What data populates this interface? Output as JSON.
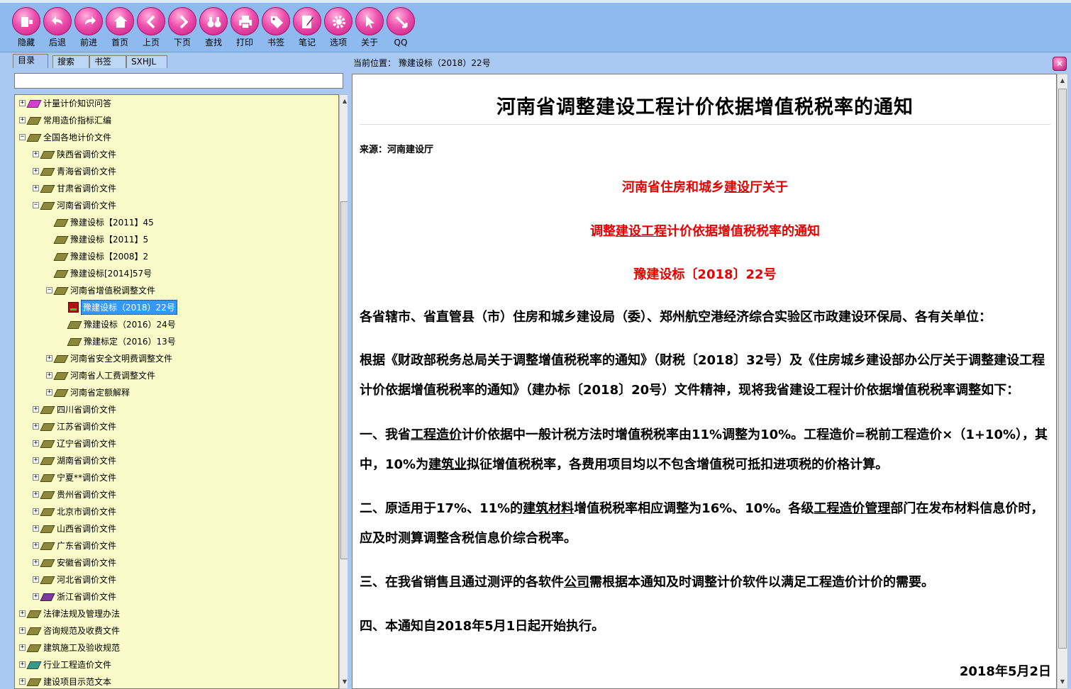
{
  "toolbar": {
    "buttons": [
      {
        "label": "隐藏",
        "icon": "hide-icon"
      },
      {
        "label": "后退",
        "icon": "back-icon"
      },
      {
        "label": "前进",
        "icon": "forward-icon"
      },
      {
        "label": "首页",
        "icon": "home-icon"
      },
      {
        "label": "上页",
        "icon": "prev-page-icon"
      },
      {
        "label": "下页",
        "icon": "next-page-icon"
      },
      {
        "label": "查找",
        "icon": "binoculars-icon"
      },
      {
        "label": "打印",
        "icon": "printer-icon"
      },
      {
        "label": "书签",
        "icon": "bookmark-tag-icon"
      },
      {
        "label": "笔记",
        "icon": "notes-icon"
      },
      {
        "label": "选项",
        "icon": "gear-icon"
      },
      {
        "label": "关于",
        "icon": "cursor-icon"
      },
      {
        "label": "QQ",
        "icon": "qq-icon"
      }
    ]
  },
  "tabs": [
    "目录",
    "搜索",
    "书签",
    "SXHJL"
  ],
  "search": {
    "value": ""
  },
  "tree": [
    {
      "label": "计量计价知识问答",
      "level": 0,
      "toggle": "+",
      "icon": "pink"
    },
    {
      "label": "常用造价指标汇编",
      "level": 0,
      "toggle": "+",
      "icon": "olive"
    },
    {
      "label": "全国各地计价文件",
      "level": 0,
      "toggle": "-",
      "icon": "olive"
    },
    {
      "label": "陕西省调价文件",
      "level": 1,
      "toggle": "+",
      "icon": "olive"
    },
    {
      "label": "青海省调价文件",
      "level": 1,
      "toggle": "+",
      "icon": "olive"
    },
    {
      "label": "甘肃省调价文件",
      "level": 1,
      "toggle": "+",
      "icon": "olive"
    },
    {
      "label": "河南省调价文件",
      "level": 1,
      "toggle": "-",
      "icon": "olive"
    },
    {
      "label": "豫建设标【2011】45",
      "level": 2,
      "toggle": "",
      "icon": "olive"
    },
    {
      "label": "豫建设标【2011】5",
      "level": 2,
      "toggle": "",
      "icon": "olive"
    },
    {
      "label": "豫建设标【2008】2",
      "level": 2,
      "toggle": "",
      "icon": "olive"
    },
    {
      "label": "豫建设标[2014]57号",
      "level": 2,
      "toggle": "",
      "icon": "olive"
    },
    {
      "label": "河南省增值税调整文件",
      "level": 2,
      "toggle": "-",
      "icon": "olive"
    },
    {
      "label": "豫建设标（2018）22号",
      "level": 3,
      "toggle": "",
      "icon": "doc",
      "selected": true
    },
    {
      "label": "豫建设标（2016）24号",
      "level": 3,
      "toggle": "",
      "icon": "olive"
    },
    {
      "label": "豫建标定（2016）13号",
      "level": 3,
      "toggle": "",
      "icon": "olive"
    },
    {
      "label": "河南省安全文明费调整文件",
      "level": 2,
      "toggle": "+",
      "icon": "olive"
    },
    {
      "label": "河南省人工费调整文件",
      "level": 2,
      "toggle": "+",
      "icon": "olive"
    },
    {
      "label": "河南省定额解释",
      "level": 2,
      "toggle": "+",
      "icon": "olive"
    },
    {
      "label": "四川省调价文件",
      "level": 1,
      "toggle": "+",
      "icon": "olive"
    },
    {
      "label": "江苏省调价文件",
      "level": 1,
      "toggle": "+",
      "icon": "olive"
    },
    {
      "label": "辽宁省调价文件",
      "level": 1,
      "toggle": "+",
      "icon": "olive"
    },
    {
      "label": "湖南省调价文件",
      "level": 1,
      "toggle": "+",
      "icon": "olive"
    },
    {
      "label": "宁夏**调价文件",
      "level": 1,
      "toggle": "+",
      "icon": "olive"
    },
    {
      "label": "贵州省调价文件",
      "level": 1,
      "toggle": "+",
      "icon": "olive"
    },
    {
      "label": "北京市调价文件",
      "level": 1,
      "toggle": "+",
      "icon": "olive"
    },
    {
      "label": "山西省调价文件",
      "level": 1,
      "toggle": "+",
      "icon": "olive"
    },
    {
      "label": "广东省调价文件",
      "level": 1,
      "toggle": "+",
      "icon": "olive"
    },
    {
      "label": "安徽省调价文件",
      "level": 1,
      "toggle": "+",
      "icon": "olive"
    },
    {
      "label": "河北省调价文件",
      "level": 1,
      "toggle": "+",
      "icon": "olive"
    },
    {
      "label": "浙江省调价文件",
      "level": 1,
      "toggle": "+",
      "icon": "purple"
    },
    {
      "label": "法律法规及管理办法",
      "level": 0,
      "toggle": "+",
      "icon": "olive"
    },
    {
      "label": "咨询规范及收费文件",
      "level": 0,
      "toggle": "+",
      "icon": "olive"
    },
    {
      "label": "建筑施工及验收规范",
      "level": 0,
      "toggle": "+",
      "icon": "olive"
    },
    {
      "label": "行业工程造价文件",
      "level": 0,
      "toggle": "+",
      "icon": "teal"
    },
    {
      "label": "建设项目示范文本",
      "level": 0,
      "toggle": "+",
      "icon": "olive"
    }
  ],
  "location": {
    "text": "当前位置：  豫建设标（2018）22号"
  },
  "document": {
    "title": "河南省调整建设工程计价依据增值税税率的通知",
    "source": "来源：河南建设厅",
    "red_line1": [
      "河南省住房和城乡",
      "建设",
      "厅关于"
    ],
    "red_line2": [
      "调整",
      "建设工程",
      "计价依据增值税税率的通知"
    ],
    "red_line3": "豫建设标〔2018〕22号",
    "salutation": "各省辖市、省直管县（市）住房和城乡建设局（委）、郑州航空港经济综合实验区市政建设环保局、各有关单位：",
    "para1": "根据《财政部税务总局关于调整增值税税率的通知》（财税〔2018〕32号）及《住房城乡建设部办公厅关于调整建设工程计价依据增值税税率的通知》（建办标〔2018〕20号）文件精神，现将我省建设工程计价依据增值税税率调整如下：",
    "item1": [
      "一、我省",
      "工程造价",
      "计价依据中一般计税方法时增值税税率由11%调整为10%。工程造价=税前工程造价×（1+10%），其中，10%为",
      "建筑业",
      "拟征增值税税率，各费用项目均以不包含增值税可抵扣进项税的价格计算。"
    ],
    "item2": [
      "二、原适用于17%、11%的",
      "建筑材料",
      "增值税税率相应调整为16%、10%。各级",
      "工程造价管理",
      "部门在发布材料信息价时，应及时测算调整含税信息价综合税率。"
    ],
    "item3": [
      "三、在我省销售且通过测评的各软件",
      "公司",
      "需根据本通知及时调整计价软件以满足工程造价计价的需要。"
    ],
    "item4": "四、本通知自2018年5月1日起开始执行。",
    "date": "2018年5月2日"
  }
}
